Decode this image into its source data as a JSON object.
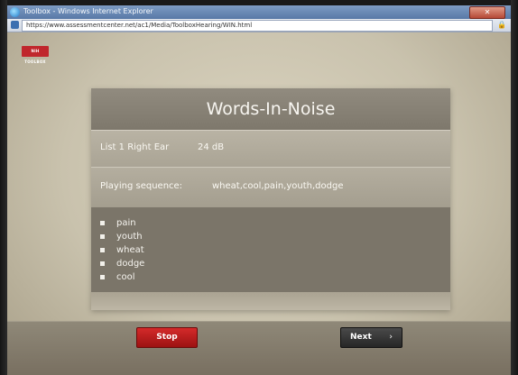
{
  "window": {
    "title": "Toolbox - Windows Internet Explorer",
    "close_label": "✕",
    "address": "https://www.assessmentcenter.net/ac1/Media/ToolboxHearing/WIN.html"
  },
  "logo_text": "NIH TOOLBOX",
  "panel": {
    "title": "Words-In-Noise",
    "list_label": "List 1 Right Ear",
    "level": "24 dB",
    "sequence_label": "Playing sequence:",
    "sequence": "wheat,cool,pain,youth,dodge",
    "words": [
      "pain",
      "youth",
      "wheat",
      "dodge",
      "cool"
    ]
  },
  "buttons": {
    "stop": "Stop",
    "next": "Next",
    "next_arrow": "›"
  },
  "colors": {
    "stop_button": "#b71d1d",
    "next_button": "#333333",
    "background": "#c9c2ad"
  }
}
